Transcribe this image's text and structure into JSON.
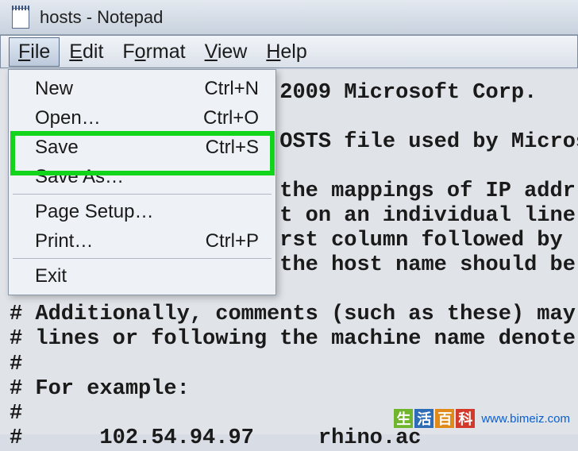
{
  "window": {
    "title": "hosts - Notepad"
  },
  "menubar": {
    "items": [
      {
        "prefix": "F",
        "rest": "ile"
      },
      {
        "prefix": "E",
        "rest": "dit"
      },
      {
        "prefix": "",
        "rest": "F",
        "mid": "o",
        "suffix": "rmat"
      },
      {
        "prefix": "V",
        "rest": "iew"
      },
      {
        "prefix": "H",
        "rest": "elp"
      }
    ]
  },
  "dropdown": {
    "items": [
      {
        "label": "New",
        "shortcut": "Ctrl+N"
      },
      {
        "label": "Open…",
        "shortcut": "Ctrl+O"
      },
      {
        "label": "Save",
        "shortcut": "Ctrl+S",
        "highlighted": true
      },
      {
        "label": "Save As…",
        "shortcut": ""
      },
      {
        "sep": true
      },
      {
        "label": "Page Setup…",
        "shortcut": ""
      },
      {
        "label": "Print…",
        "shortcut": "Ctrl+P"
      },
      {
        "sep": true
      },
      {
        "label": "Exit",
        "shortcut": ""
      }
    ]
  },
  "editor": {
    "content": "                     2009 Microsoft Corp.\n#\n                     OSTS file used by Micros\n#\n                     the mappings of IP addr\n                     t on an individual line\n                     rst column followed by \n                     the host name should be\n\n# Additionally, comments (such as these) may\n# lines or following the machine name denote\n#\n# For example:\n#\n#      102.54.94.97     rhino.ac"
  },
  "watermark": {
    "chars": [
      "生",
      "活",
      "百",
      "科"
    ],
    "url": "www.bimeiz.com"
  }
}
